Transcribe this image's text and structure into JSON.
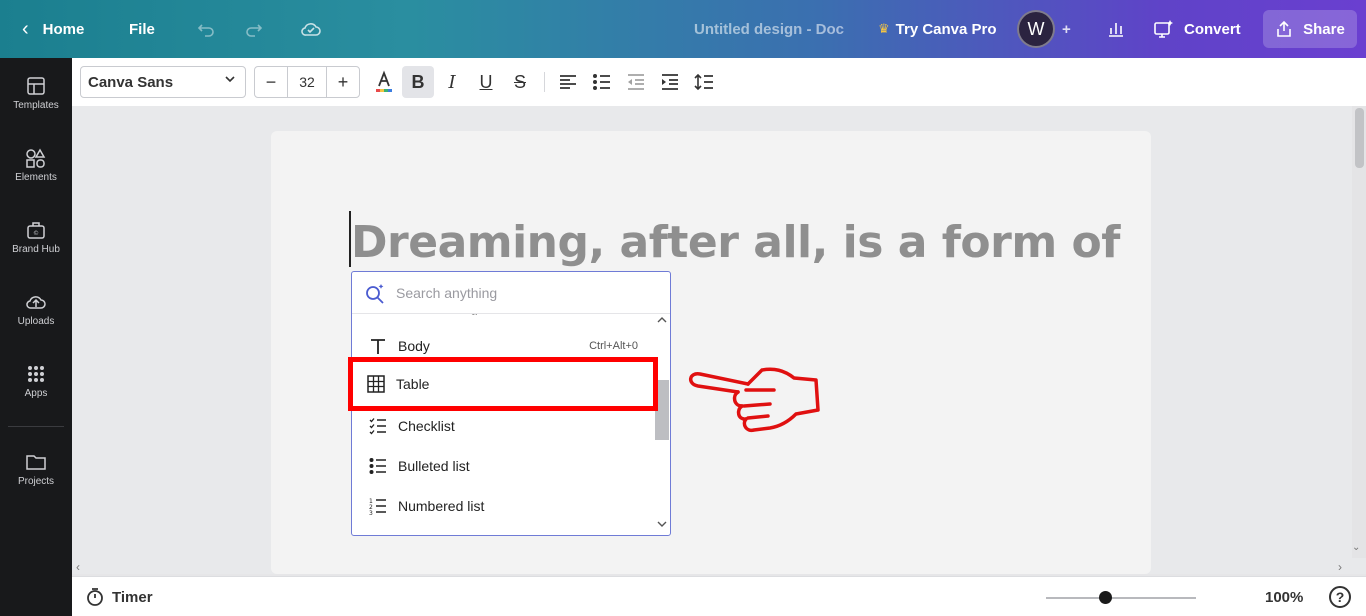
{
  "topbar": {
    "home_label": "Home",
    "file_label": "File",
    "doc_title": "Untitled design - Doc",
    "try_pro_label": "Try Canva Pro",
    "avatar_initial": "W",
    "convert_label": "Convert",
    "share_label": "Share"
  },
  "sidebar": {
    "items": [
      {
        "label": "Templates",
        "icon": "templates-icon"
      },
      {
        "label": "Elements",
        "icon": "elements-icon"
      },
      {
        "label": "Brand Hub",
        "icon": "brand-hub-icon"
      },
      {
        "label": "Uploads",
        "icon": "uploads-icon"
      },
      {
        "label": "Apps",
        "icon": "apps-icon"
      },
      {
        "label": "Projects",
        "icon": "projects-icon"
      }
    ]
  },
  "toolbar": {
    "font_family": "Canva Sans",
    "font_size": "32",
    "minus": "−",
    "plus": "+"
  },
  "document": {
    "headline": "Dreaming, after all, is a form of"
  },
  "popup": {
    "search_placeholder": "Search anything",
    "items": [
      {
        "label": "Body",
        "shortcut": "Ctrl+Alt+0",
        "icon": "text-icon"
      },
      {
        "label": "Table",
        "icon": "table-icon",
        "highlighted": true
      },
      {
        "label": "Checklist",
        "icon": "checklist-icon"
      },
      {
        "label": "Bulleted list",
        "icon": "bulleted-list-icon"
      },
      {
        "label": "Numbered list",
        "icon": "numbered-list-icon"
      }
    ]
  },
  "footer": {
    "timer_label": "Timer",
    "zoom": "100%",
    "help": "?"
  },
  "colors": {
    "highlight": "#ff0000",
    "topbar_start": "#1b7f8f",
    "topbar_end": "#6a3fd0"
  }
}
